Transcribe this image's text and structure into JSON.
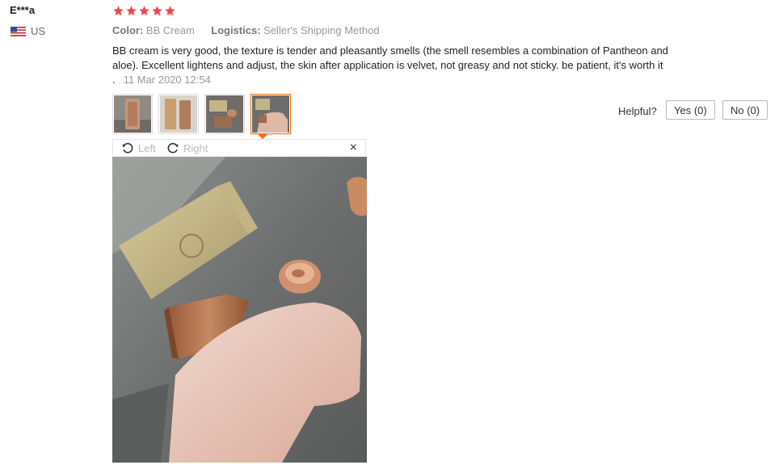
{
  "review": {
    "user": "E***a",
    "country": "US",
    "rating_stars": 5,
    "color_label": "Color:",
    "color_value": "BB Cream",
    "logistics_label": "Logistics:",
    "logistics_value": "Seller's Shipping Method",
    "text": "BB cream is very good, the texture is tender and pleasantly smells (the smell resembles a combination of Pantheon and aloe). Excellent lightens and adjust, the skin after application is velvet, not greasy and not sticky. be patient, it's worth it .",
    "date": "11 Mar 2020 12:54"
  },
  "helpful": {
    "label": "Helpful?",
    "yes": "Yes (0)",
    "no": "No (0)"
  },
  "viewer": {
    "rotate_left": "Left",
    "rotate_right": "Right",
    "close": "×",
    "selected_thumbnail": 4,
    "thumbnail_count": 4
  },
  "colors": {
    "star": "#f0484b",
    "accent": "#ff6a00"
  },
  "icons": [
    "us-flag-icon",
    "star-icon",
    "rotate-left-icon",
    "rotate-right-icon",
    "close-icon"
  ]
}
